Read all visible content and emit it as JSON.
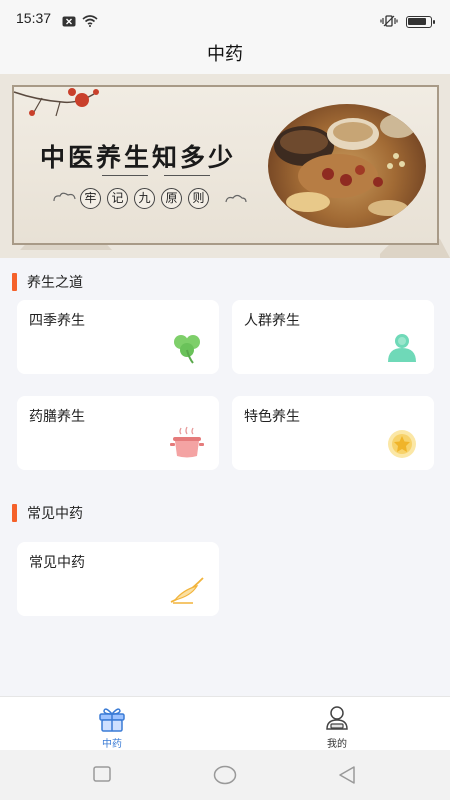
{
  "status_bar": {
    "time": "15:37",
    "left_icons": [
      "notification-close-icon",
      "wifi-icon"
    ],
    "right_icons": [
      "vibrate-icon",
      "battery-icon"
    ],
    "battery_level": 0.85
  },
  "nav": {
    "title": "中药"
  },
  "banner": {
    "title": "中医养生知多少",
    "subtitle_chars": [
      "牢",
      "记",
      "九",
      "原",
      "则"
    ]
  },
  "sections": [
    {
      "title": "养生之道",
      "cards": [
        {
          "label": "四季养生",
          "icon": "clover-icon"
        },
        {
          "label": "人群养生",
          "icon": "people-icon"
        },
        {
          "label": "药膳养生",
          "icon": "pot-icon"
        },
        {
          "label": "特色养生",
          "icon": "star-badge-icon"
        }
      ]
    },
    {
      "title": "常见中药",
      "cards": [
        {
          "label": "常见中药",
          "icon": "herb-icon"
        }
      ]
    }
  ],
  "tab_bar": {
    "tabs": [
      {
        "label": "中药",
        "icon": "gift-box-icon",
        "active": true
      },
      {
        "label": "我的",
        "icon": "user-icon",
        "active": false
      }
    ]
  },
  "colors": {
    "accent": "#f5612a",
    "tab_active": "#3a7bd5",
    "tab_inactive": "#333333",
    "page_bg": "#f4f5f9"
  },
  "system_nav": [
    "square-icon",
    "circle-icon",
    "back-triangle-icon"
  ]
}
